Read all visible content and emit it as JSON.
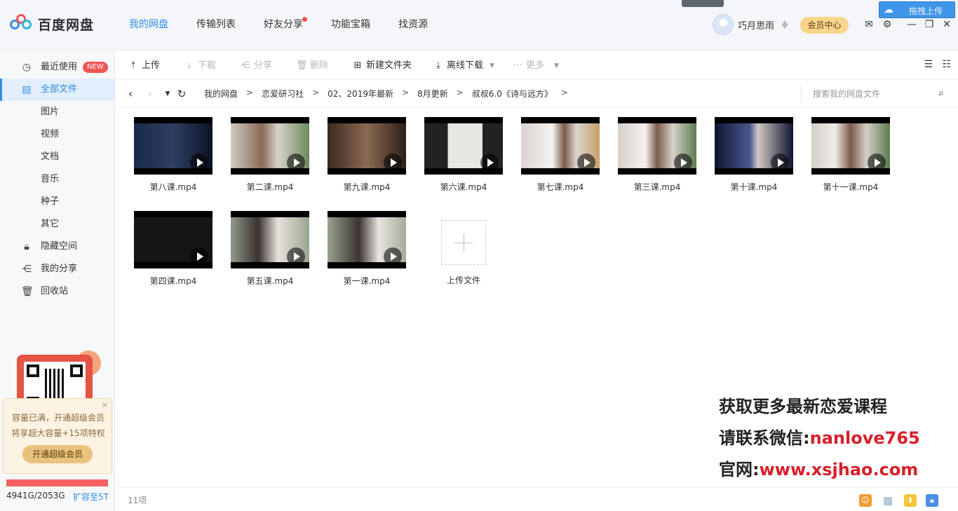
{
  "app": {
    "logo_text": "百度网盘",
    "nav": [
      {
        "label": "我的网盘",
        "active": true
      },
      {
        "label": "传输列表"
      },
      {
        "label": "好友分享",
        "dot": true
      },
      {
        "label": "功能宝箱"
      },
      {
        "label": "找资源"
      }
    ],
    "user": {
      "name": "巧月思雨",
      "vip_label": "会员中心"
    },
    "upload_tip": "拖拽上传",
    "colors": {
      "accent": "#2f8ce6",
      "badge": "#f25353",
      "vip": "#f7d68c"
    }
  },
  "sidebar": {
    "items": [
      {
        "label": "最近使用",
        "badge": "NEW",
        "icon": "clock-icon"
      },
      {
        "label": "全部文件",
        "icon": "file-icon",
        "active": true
      },
      {
        "label": "图片"
      },
      {
        "label": "视频"
      },
      {
        "label": "文档"
      },
      {
        "label": "音乐"
      },
      {
        "label": "种子"
      },
      {
        "label": "其它"
      },
      {
        "label": "隐藏空间",
        "icon": "lock-icon"
      },
      {
        "label": "我的分享",
        "icon": "share-icon"
      },
      {
        "label": "回收站",
        "icon": "trash-icon"
      }
    ],
    "promo": {
      "line1": "容量已满，开通超级会员",
      "line2": "将享超大容量+15项特权",
      "button": "开通超级会员",
      "close": "×"
    },
    "quota": {
      "used_text": "4941G/2053G",
      "expand": "扩容至5T",
      "used_fraction": 1.0
    }
  },
  "toolbar": {
    "upload": "上传",
    "download": "下载",
    "share": "分享",
    "delete": "删除",
    "new_folder": "新建文件夹",
    "offline_download": "离线下载",
    "more": "更多"
  },
  "path": {
    "crumbs": [
      "我的网盘",
      "恋爱研习社",
      "02、2019年最新",
      "8月更新",
      "叔叔6.0《诗与远方》"
    ],
    "search_placeholder": "搜索我的网盘文件"
  },
  "files": [
    {
      "name": "第八课.mp4"
    },
    {
      "name": "第二课.mp4"
    },
    {
      "name": "第九课.mp4"
    },
    {
      "name": "第六课.mp4"
    },
    {
      "name": "第七课.mp4"
    },
    {
      "name": "第三课.mp4"
    },
    {
      "name": "第十课.mp4"
    },
    {
      "name": "第十一课.mp4"
    },
    {
      "name": "第四课.mp4"
    },
    {
      "name": "第五课.mp4"
    },
    {
      "name": "第一课.mp4"
    }
  ],
  "upload_file_label": "上传文件",
  "watermark": {
    "line1": "获取更多最新恋爱课程",
    "line2_prefix": "请联系微信:",
    "line2_value": "nanlove765",
    "line3_prefix": "官网:",
    "line3_value": "www.xsjhao.com"
  },
  "status": {
    "count": "11项"
  }
}
